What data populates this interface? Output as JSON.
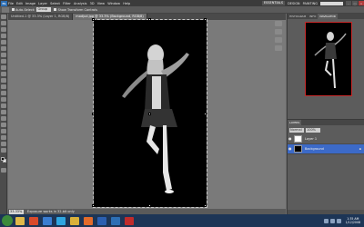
{
  "app": {
    "logo": "Ps",
    "menu": [
      "File",
      "Edit",
      "Image",
      "Layer",
      "Select",
      "Filter",
      "Analysis",
      "3D",
      "View",
      "Window",
      "Help"
    ],
    "workspace_active": "ESSENTIALS",
    "workspace_links": [
      "DESIGN",
      "PAINTING"
    ]
  },
  "options_bar": {
    "checkbox_label": "Auto-Select:",
    "select_value": "Group",
    "transform_label": "Show Transform Controls"
  },
  "documents": {
    "tabs": [
      "Untitled-1 @ 33.3% (Layer 1, RGB/8)",
      "modjud.jpg @ 33.3% (Background, RGB/8)"
    ],
    "active_index": 1
  },
  "status": {
    "zoom": "33.33%",
    "doc_info": "Exposure works in 32-bit only"
  },
  "panels": {
    "top_tabs": [
      "HISTOGRAM",
      "INFO",
      "NAVIGATOR"
    ],
    "layers_tabs": [
      "LAYERS"
    ],
    "blend_mode": "Normal",
    "opacity": "100%",
    "layers": [
      {
        "name": "Layer 1",
        "thumb": "white",
        "selected": false
      },
      {
        "name": "Background",
        "thumb": "black",
        "selected": true
      }
    ]
  },
  "taskbar": {
    "time": "1:35 AM",
    "date": "1/12/2008",
    "apps": [
      {
        "name": "explorer",
        "color": "#e0b94a"
      },
      {
        "name": "media-player",
        "color": "#d84a2b"
      },
      {
        "name": "browser",
        "color": "#3a7dd1"
      },
      {
        "name": "skype",
        "color": "#2fa6e0"
      },
      {
        "name": "chrome",
        "color": "#d9b13a"
      },
      {
        "name": "firefox",
        "color": "#e36b2a"
      },
      {
        "name": "word",
        "color": "#2b5fb0"
      },
      {
        "name": "photoshop",
        "color": "#2d6fb5"
      },
      {
        "name": "acrobat",
        "color": "#c02b2b"
      }
    ]
  }
}
